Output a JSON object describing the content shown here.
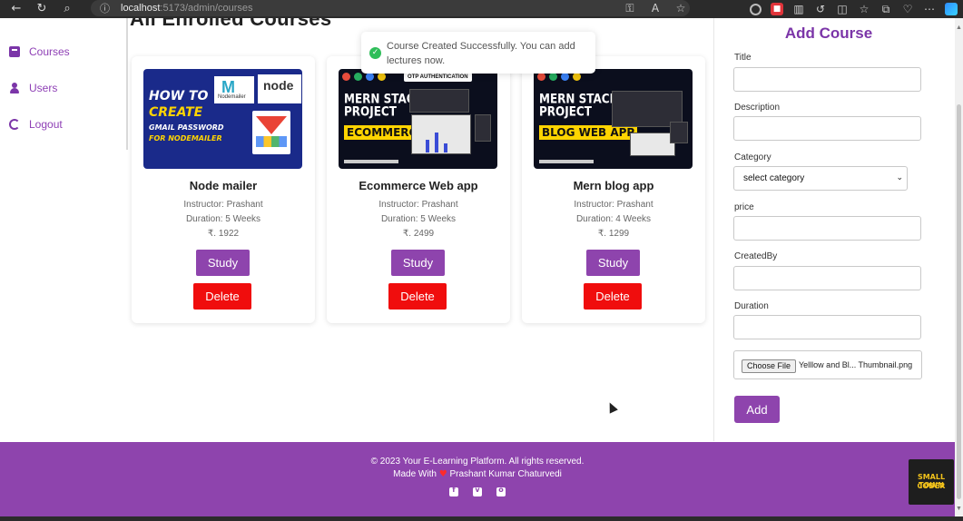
{
  "browser": {
    "url_host": "localhost",
    "url_path": ":5173/admin/courses"
  },
  "sidebar": {
    "items": [
      {
        "label": "Courses",
        "icon": "book-icon"
      },
      {
        "label": "Users",
        "icon": "user-icon"
      },
      {
        "label": "Logout",
        "icon": "logout-icon"
      }
    ]
  },
  "main": {
    "heading": "All Enrolled Courses",
    "courses": [
      {
        "title": "Node mailer",
        "instructor": "Instructor: Prashant",
        "duration": "Duration: 5 Weeks",
        "price": "₹. 1922",
        "study_label": "Study",
        "delete_label": "Delete",
        "thumb": {
          "line1": "HOW TO",
          "line2": "CREATE",
          "line3": "GMAIL PASSWORD",
          "line4": "FOR NODEMAILER",
          "nm_label": "Nodemailer",
          "node_label": "node"
        }
      },
      {
        "title": "Ecommerce Web app",
        "instructor": "Instructor: Prashant",
        "duration": "Duration: 5 Weeks",
        "price": "₹. 2499",
        "study_label": "Study",
        "delete_label": "Delete",
        "thumb": {
          "badge": "OTP AUTHENTICATION",
          "line1": "MERN STACK",
          "line2": "PROJECT",
          "highlight": "ECOMMERCE"
        }
      },
      {
        "title": "Mern blog app",
        "instructor": "Instructor: Prashant",
        "duration": "Duration: 4 Weeks",
        "price": "₹. 1299",
        "study_label": "Study",
        "delete_label": "Delete",
        "thumb": {
          "line1": "MERN STACK",
          "line2": "PROJECT",
          "highlight": "BLOG WEB APP"
        }
      }
    ]
  },
  "toast": {
    "message": "Course Created Successfully. You can add lectures now."
  },
  "form": {
    "title": "Add Course",
    "labels": {
      "title": "Title",
      "description": "Description",
      "category": "Category",
      "price": "price",
      "created_by": "CreatedBy",
      "duration": "Duration"
    },
    "category_selected": "select category",
    "file_button": "Choose File",
    "file_name": "Yelllow and Bl... Thumbnail.png",
    "submit_label": "Add"
  },
  "footer": {
    "copyright": "© 2023 Your E-Learning Platform. All rights reserved.",
    "made_with_prefix": "Made With",
    "made_with_author": "Prashant Kumar Chaturvedi"
  },
  "watermark": {
    "line1": "SMALL TOWN",
    "line2": "CODER"
  },
  "colors": {
    "accent": "#8e44ad",
    "delete": "#f00d0d",
    "success": "#2fbe5a"
  }
}
